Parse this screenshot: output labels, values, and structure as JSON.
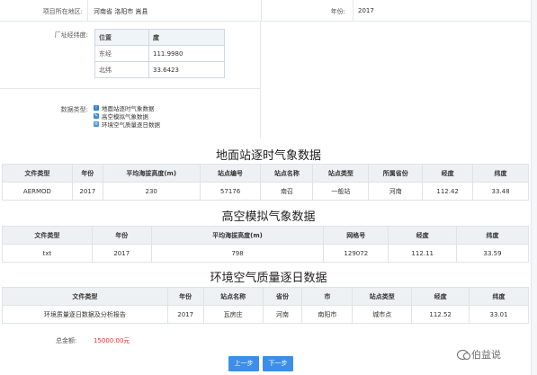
{
  "top": {
    "location_label": "项目所在地区:",
    "location_value": "河南省  洛阳市  嵩县",
    "year_label": "年份:",
    "year_value": "2017"
  },
  "coords": {
    "label": "厂址经纬度:",
    "header": [
      "位置",
      "度"
    ],
    "rows": [
      {
        "name": "东经",
        "value": "111.9980"
      },
      {
        "name": "北纬",
        "value": "33.6423"
      }
    ]
  },
  "data_types": {
    "label": "数据类型:",
    "items": [
      "地面站逐时气象数据",
      "高空模拟气象数据",
      "环境空气质量逐日数据"
    ]
  },
  "surface": {
    "title": "地面站逐时气象数据",
    "headers": [
      "文件类型",
      "年份",
      "平均海拔高度(m)",
      "站点编号",
      "站点名称",
      "站点类型",
      "所属省份",
      "经度",
      "纬度"
    ],
    "row": [
      "AERMOD",
      "2017",
      "230",
      "57176",
      "南召",
      "一般站",
      "河南",
      "112.42",
      "33.48"
    ]
  },
  "upper": {
    "title": "高空模拟气象数据",
    "headers": [
      "文件类型",
      "年份",
      "平均海拔高度(m)",
      "网格号",
      "经度",
      "纬度"
    ],
    "row": [
      "txt",
      "2017",
      "798",
      "129072",
      "112.11",
      "33.59"
    ]
  },
  "air": {
    "title": "环境空气质量逐日数据",
    "headers": [
      "文件类型",
      "年份",
      "站点名称",
      "省份",
      "市",
      "站点类型",
      "经度",
      "纬度"
    ],
    "row": [
      "环境质量逐日数据及分析报告",
      "2017",
      "瓦房庄",
      "河南",
      "南阳市",
      "城市点",
      "112.52",
      "33.01"
    ]
  },
  "total": {
    "label": "总金额:",
    "value": "15000.00元"
  },
  "buttons": {
    "prev": "上一步",
    "next": "下一步"
  },
  "watermark": "伯益说",
  "colors": {
    "accent": "#3d8ee8",
    "price": "#e23a2e"
  }
}
